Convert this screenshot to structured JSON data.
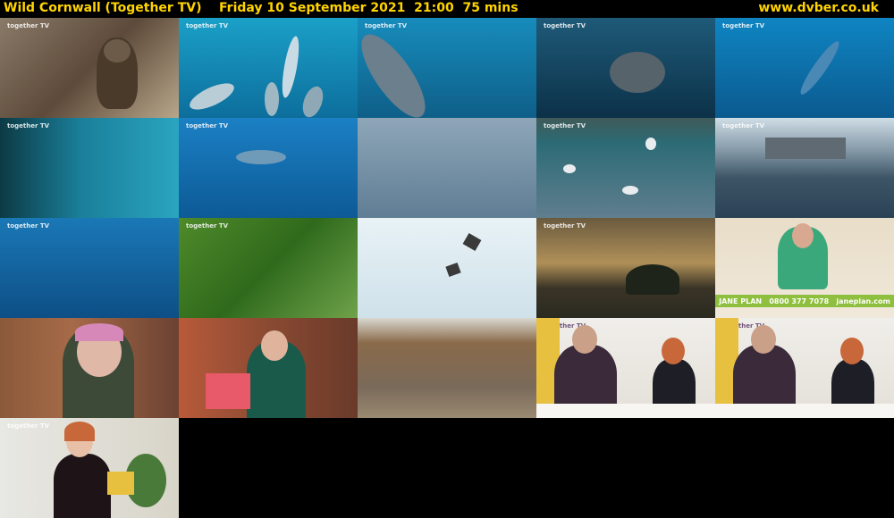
{
  "header": {
    "program": "Wild Cornwall (Together TV)",
    "date": "Friday 10 September 2021",
    "time": "21:00",
    "duration": "75 mins",
    "site": "www.dvber.co.uk"
  },
  "channel_logo": "together TV",
  "colors": {
    "header_text": "#ffd400",
    "background": "#000000"
  },
  "thumbnails": [
    {
      "scene": "falcon-nest",
      "logo": true
    },
    {
      "scene": "dolphins-underwater",
      "logo": true
    },
    {
      "scene": "dolphin-closeup",
      "logo": true
    },
    {
      "scene": "basking-shark",
      "logo": true
    },
    {
      "scene": "dolphin-blue",
      "logo": true
    },
    {
      "scene": "underwater-kelp",
      "logo": true
    },
    {
      "scene": "fish-shoal",
      "logo": false
    },
    {
      "scene": "sea-surface-fish",
      "logo": false
    },
    {
      "scene": "gulls-feeding",
      "logo": true
    },
    {
      "scene": "harbour-crowd",
      "logo": true
    },
    {
      "scene": "underwater-shoal",
      "logo": true
    },
    {
      "scene": "green-cliff-bird",
      "logo": true
    },
    {
      "scene": "birds-sky",
      "logo": false
    },
    {
      "scene": "sunset-landscape",
      "logo": true
    },
    {
      "scene": "advert-presenter",
      "logo": false
    },
    {
      "scene": "woman-interview-street",
      "logo": false
    },
    {
      "scene": "woman-interview-bunting",
      "logo": false
    },
    {
      "scene": "back-alley",
      "logo": false
    },
    {
      "scene": "studio-presenters",
      "logo": true
    },
    {
      "scene": "studio-presenters-2",
      "logo": true
    },
    {
      "scene": "woman-office",
      "logo": true
    }
  ],
  "advert": {
    "brand": "JANE PLAN",
    "phone": "0800 377 7078",
    "web": "janeplan.com"
  }
}
